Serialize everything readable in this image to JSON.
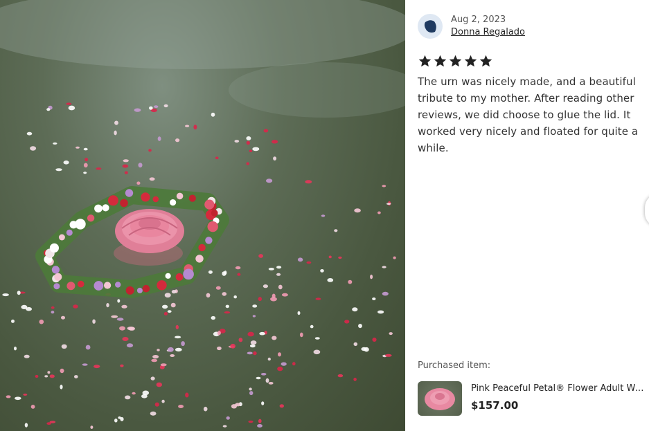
{
  "photo": {
    "alt_icon": "review-photo"
  },
  "review": {
    "date": "Aug 2, 2023",
    "reviewer": "Donna Regalado",
    "rating": 5,
    "text": "The urn was nicely made, and a beautiful tribute to my mother. After reading other reviews, we did choose to glue the lid. It worked very nicely and floated for quite a while."
  },
  "purchase": {
    "label": "Purchased item:",
    "title": "Pink Peaceful Petal® Flower Adult Water Urn",
    "price": "$157.00"
  },
  "colors": {
    "star": "#222222",
    "avatar_bg": "#dfe8f3",
    "avatar_icon": "#1f3a60",
    "water": "#55644d"
  }
}
